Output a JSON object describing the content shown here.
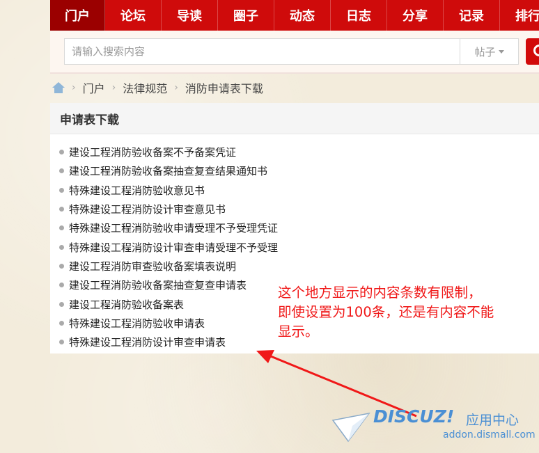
{
  "nav": {
    "items": [
      {
        "label": "门户"
      },
      {
        "label": "论坛"
      },
      {
        "label": "导读"
      },
      {
        "label": "圈子"
      },
      {
        "label": "动态"
      },
      {
        "label": "日志"
      },
      {
        "label": "分享"
      },
      {
        "label": "记录"
      },
      {
        "label": "排行"
      }
    ]
  },
  "search": {
    "placeholder": "请输入搜索内容",
    "type_selected": "帖子",
    "button_icon": "search-icon"
  },
  "breadcrumb": {
    "home_icon": "home-icon",
    "items": [
      "门户",
      "法律规范",
      "消防申请表下载"
    ]
  },
  "panel": {
    "title": "申请表下载",
    "items": [
      "建设工程消防验收备案不予备案凭证",
      "建设工程消防验收备案抽查复查结果通知书",
      "特殊建设工程消防验收意见书",
      "特殊建设工程消防设计审查意见书",
      "特殊建设工程消防验收申请受理不予受理凭证",
      "特殊建设工程消防设计审查申请受理不予受理",
      "建设工程消防审查验收备案填表说明",
      "建设工程消防验收备案抽查复查申请表",
      "建设工程消防验收备案表",
      "特殊建设工程消防验收申请表",
      "特殊建设工程消防设计审查申请表"
    ]
  },
  "annotation": {
    "line1": "这个地方显示的内容条数有限制，",
    "line2": "即使设置为100条，还是有内容不能",
    "line3": "显示。",
    "color": "#f01818"
  },
  "watermark": {
    "logo": "DISCUZ!",
    "app": "应用中心",
    "url": "addon.dismall.com"
  }
}
